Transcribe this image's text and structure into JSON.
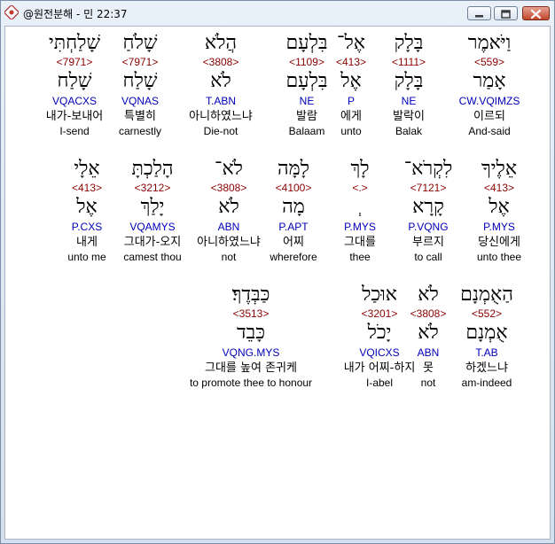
{
  "window": {
    "title": "@원전분해 - 민 22:37",
    "icon": "app-icon",
    "buttons": [
      "minimize-icon",
      "maximize-icon",
      "close-icon"
    ]
  },
  "colors": {
    "strong": "#8b0000",
    "morph": "#0000b8",
    "highlight": "#ffffff",
    "client_bg": "#ffffff"
  },
  "rows": [
    {
      "words": [
        {
          "heb": "וַיֹּאמֶר",
          "strong": "<559>",
          "lemma": "אָמַר",
          "morph": "CW.VQIMZS",
          "kor": "이르되",
          "eng": "And-said",
          "selected": true
        },
        {
          "heb": "בָּלָק",
          "strong": "<1111>",
          "lemma": "בָּלָק",
          "morph": "NE",
          "kor": "발락이",
          "eng": "Balak"
        },
        {
          "heb": "אֶל־",
          "strong": "<413>",
          "lemma": "אֶל",
          "morph": "P",
          "kor": "에게",
          "eng": "unto"
        },
        {
          "heb": "בִּלְעָם",
          "strong": "<1109>",
          "lemma": "בִּלְעָם",
          "morph": "NE",
          "kor": "발람",
          "eng": "Balaam"
        },
        {
          "heb": "הֲלֹא",
          "strong": "<3808>",
          "lemma": "לֹא",
          "morph": "T.ABN",
          "kor": "아니하였느냐",
          "eng": "Die-not"
        },
        {
          "heb": "שָׁלֹחַ",
          "strong": "<7971>",
          "lemma": "שָׁלַח",
          "morph": "VQNAS",
          "kor": "특별히",
          "eng": "carnestly"
        },
        {
          "heb": "שָׁלַחְתִּי",
          "strong": "<7971>",
          "lemma": "שָׁלַח",
          "morph": "VQACXS",
          "kor": "내가-보내어",
          "eng": "I-send"
        }
      ]
    },
    {
      "words": [
        {
          "heb": "אֵלֶיךָ",
          "strong": "<413>",
          "lemma": "אֶל",
          "morph": "P.MYS",
          "kor": "당신에게",
          "eng": "unto thee"
        },
        {
          "heb": "לִקְרֹא־",
          "strong": "<7121>",
          "lemma": "קָרָא",
          "morph": "P.VQNG",
          "kor": "부르지",
          "eng": "to call"
        },
        {
          "heb": "לָךְ",
          "strong": "<.>",
          "lemma": "ְ",
          "morph": "P.MYS",
          "kor": "그대를",
          "eng": "thee"
        },
        {
          "heb": "לָמָּה",
          "strong": "<4100>",
          "lemma": "מָה",
          "morph": "P.APT",
          "kor": "어찌",
          "eng": "wherefore"
        },
        {
          "heb": "לֹא־",
          "strong": "<3808>",
          "lemma": "לֹא",
          "morph": "ABN",
          "kor": "아니하였느냐",
          "eng": "not"
        },
        {
          "heb": "הָלַכְתָּ",
          "strong": "<3212>",
          "lemma": "יָלַךְ",
          "morph": "VQAMYS",
          "kor": "그대가-오지",
          "eng": "camest thou"
        },
        {
          "heb": "אֵלָי",
          "strong": "<413>",
          "lemma": "אֶל",
          "morph": "P.CXS",
          "kor": "내게",
          "eng": "unto me"
        }
      ]
    },
    {
      "words": [
        {
          "heb": "הַאֻמְנָם",
          "strong": "<552>",
          "lemma": "אֻמְנָם",
          "morph": "T.AB",
          "kor": "하겠느냐",
          "eng": "am-indeed"
        },
        {
          "heb": "לֹא",
          "strong": "<3808>",
          "lemma": "לֹא",
          "morph": "ABN",
          "kor": "못",
          "eng": "not"
        },
        {
          "heb": "אוּכַל",
          "strong": "<3201>",
          "lemma": "יָכֹל",
          "morph": "VQICXS",
          "kor": "내가 어찌-하지",
          "eng": "I-abel"
        },
        {
          "heb": "כַּבְּדֶךָ׃",
          "strong": "<3513>",
          "lemma": "כָּבֵד",
          "morph": "VQNG.MYS",
          "kor": "그대를 높여 존귀케",
          "eng": "to promote thee to honour"
        }
      ]
    }
  ]
}
